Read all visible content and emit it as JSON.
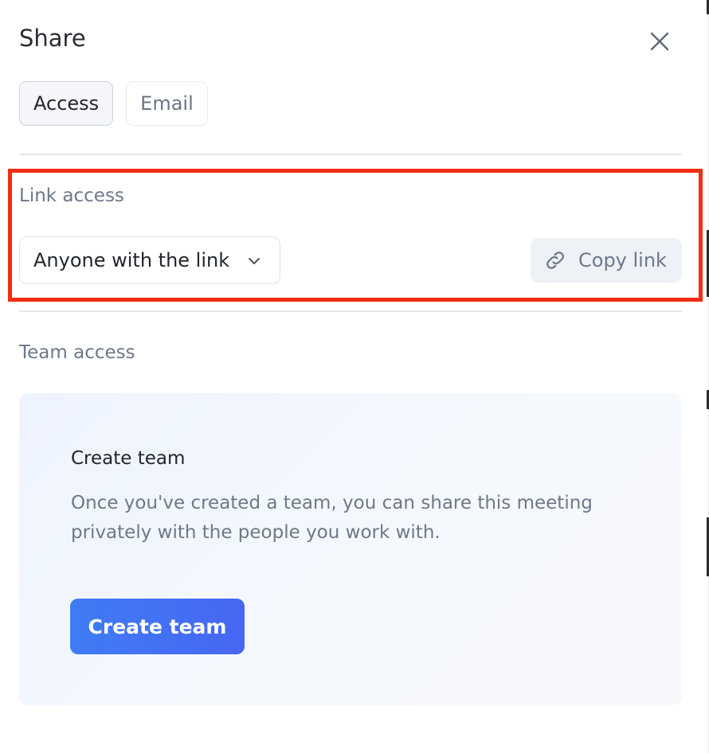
{
  "dialog": {
    "title": "Share",
    "close_icon": "close-icon"
  },
  "tabs": [
    {
      "label": "Access",
      "active": true
    },
    {
      "label": "Email",
      "active": false
    }
  ],
  "link_access": {
    "label": "Link access",
    "select_value": "Anyone with the link",
    "select_icon": "chevron-down-icon",
    "copy_label": "Copy link",
    "copy_icon": "link-icon"
  },
  "team_access": {
    "label": "Team access",
    "card_title": "Create team",
    "card_description": "Once you've created a team, you can share this meeting privately with the people you work with.",
    "button_label": "Create team"
  },
  "colors": {
    "accent": "#4470f4",
    "highlight_border": "#f22d12",
    "muted_text": "#6d7889",
    "primary_text": "#22262c"
  }
}
